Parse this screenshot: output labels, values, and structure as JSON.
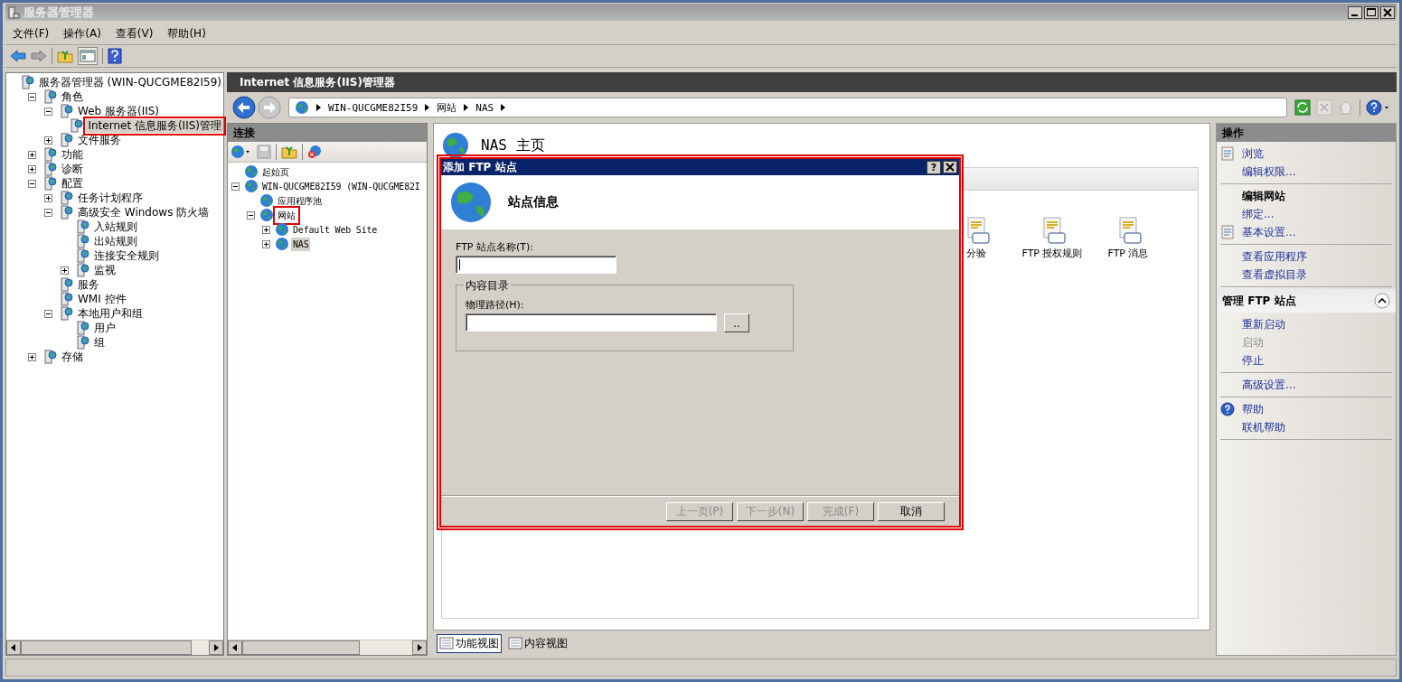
{
  "window": {
    "title": "服务器管理器"
  },
  "menu": [
    "文件(F)",
    "操作(A)",
    "查看(V)",
    "帮助(H)"
  ],
  "help_button": "?",
  "tree": [
    {
      "label": "服务器管理器 (WIN-QUCGME82I59)",
      "selected": false,
      "highlighted": false,
      "children": [
        {
          "label": "角色",
          "expanded": true,
          "selected": false,
          "highlighted": false,
          "children": [
            {
              "label": "Web 服务器(IIS)",
              "expanded": true,
              "selected": false,
              "highlighted": false,
              "children": [
                {
                  "label": "Internet 信息服务(IIS)管理",
                  "selected": true,
                  "highlighted": true
                }
              ]
            },
            {
              "label": "文件服务",
              "expanded": false,
              "selected": false,
              "highlighted": false
            }
          ]
        },
        {
          "label": "功能",
          "expanded": false,
          "selected": false,
          "highlighted": false
        },
        {
          "label": "诊断",
          "expanded": false,
          "selected": false,
          "highlighted": false
        },
        {
          "label": "配置",
          "expanded": true,
          "selected": false,
          "highlighted": false,
          "children": [
            {
              "label": "任务计划程序",
              "expanded": false,
              "selected": false,
              "highlighted": false
            },
            {
              "label": "高级安全 Windows 防火墙",
              "expanded": true,
              "selected": false,
              "highlighted": false,
              "children": [
                {
                  "label": "入站规则",
                  "selected": false,
                  "highlighted": false
                },
                {
                  "label": "出站规则",
                  "selected": false,
                  "highlighted": false
                },
                {
                  "label": "连接安全规则",
                  "selected": false,
                  "highlighted": false
                },
                {
                  "label": "监视",
                  "expanded": false,
                  "selected": false,
                  "highlighted": false
                }
              ]
            },
            {
              "label": "服务",
              "selected": false,
              "highlighted": false
            },
            {
              "label": "WMI 控件",
              "selected": false,
              "highlighted": false
            },
            {
              "label": "本地用户和组",
              "expanded": true,
              "selected": false,
              "highlighted": false,
              "children": [
                {
                  "label": "用户",
                  "selected": false,
                  "highlighted": false
                },
                {
                  "label": "组",
                  "selected": false,
                  "highlighted": false
                }
              ]
            }
          ]
        },
        {
          "label": "存储",
          "expanded": false,
          "selected": false,
          "highlighted": false
        }
      ]
    }
  ],
  "iis": {
    "title": "Internet 信息服务(IIS)管理器",
    "breadcrumb": [
      "WIN-QUCGME82I59",
      "网站",
      "NAS"
    ]
  },
  "connections": {
    "title": "连接",
    "tree": [
      {
        "label": "起始页",
        "selected": false,
        "highlighted": false
      },
      {
        "label": "WIN-QUCGME82I59 (WIN-QUCGME82I",
        "expanded": true,
        "selected": false,
        "highlighted": false,
        "children": [
          {
            "label": "应用程序池",
            "selected": false,
            "highlighted": false
          },
          {
            "label": "网站",
            "expanded": true,
            "selected": false,
            "highlighted": true,
            "children": [
              {
                "label": "Default Web Site",
                "expanded": false,
                "selected": false,
                "highlighted": false
              },
              {
                "label": "NAS",
                "expanded": false,
                "selected": true,
                "highlighted": false
              }
            ]
          }
        ]
      }
    ]
  },
  "page": {
    "title": "NAS 主页",
    "features": [
      {
        "label": "分验"
      },
      {
        "label": "FTP 授权规则"
      },
      {
        "label": "FTP 消息"
      }
    ]
  },
  "view_tabs": [
    {
      "label": "功能视图",
      "selected": true
    },
    {
      "label": "内容视图",
      "selected": false
    }
  ],
  "actions": {
    "title": "操作",
    "groups": [
      {
        "items": [
          {
            "label": "浏览",
            "kind": "iconlink",
            "disabled": false
          },
          {
            "label": "编辑权限...",
            "kind": "link",
            "disabled": false
          }
        ]
      },
      {
        "items": [
          {
            "label": "编辑网站",
            "kind": "heading",
            "disabled": false
          },
          {
            "label": "绑定...",
            "kind": "link",
            "disabled": false
          },
          {
            "label": "基本设置...",
            "kind": "iconlink",
            "disabled": false
          }
        ]
      },
      {
        "items": [
          {
            "label": "查看应用程序",
            "kind": "link",
            "disabled": false
          },
          {
            "label": "查看虚拟目录",
            "kind": "link",
            "disabled": false
          }
        ]
      }
    ],
    "section": {
      "title": "管理 FTP 站点",
      "expanded": true,
      "groups": [
        {
          "items": [
            {
              "label": "重新启动",
              "kind": "link",
              "disabled": false
            },
            {
              "label": "启动",
              "kind": "link",
              "disabled": true
            },
            {
              "label": "停止",
              "kind": "link",
              "disabled": false
            }
          ]
        },
        {
          "items": [
            {
              "label": "高级设置...",
              "kind": "link",
              "disabled": false
            }
          ]
        },
        {
          "items": [
            {
              "label": "帮助",
              "kind": "iconlink",
              "disabled": false
            },
            {
              "label": "联机帮助",
              "kind": "link",
              "disabled": false
            }
          ]
        }
      ]
    }
  },
  "dialog": {
    "title": "添加 FTP 站点",
    "highlighted": true,
    "heading": "站点信息",
    "name_label": "FTP 站点名称(T):",
    "group_label": "内容目录",
    "path_label": "物理路径(H):",
    "browse_button": "..",
    "buttons": [
      {
        "label": "上一页(P)",
        "disabled": true
      },
      {
        "label": "下一步(N)",
        "disabled": true
      },
      {
        "label": "完成(F)",
        "disabled": true
      },
      {
        "label": "取消",
        "disabled": false
      }
    ]
  }
}
